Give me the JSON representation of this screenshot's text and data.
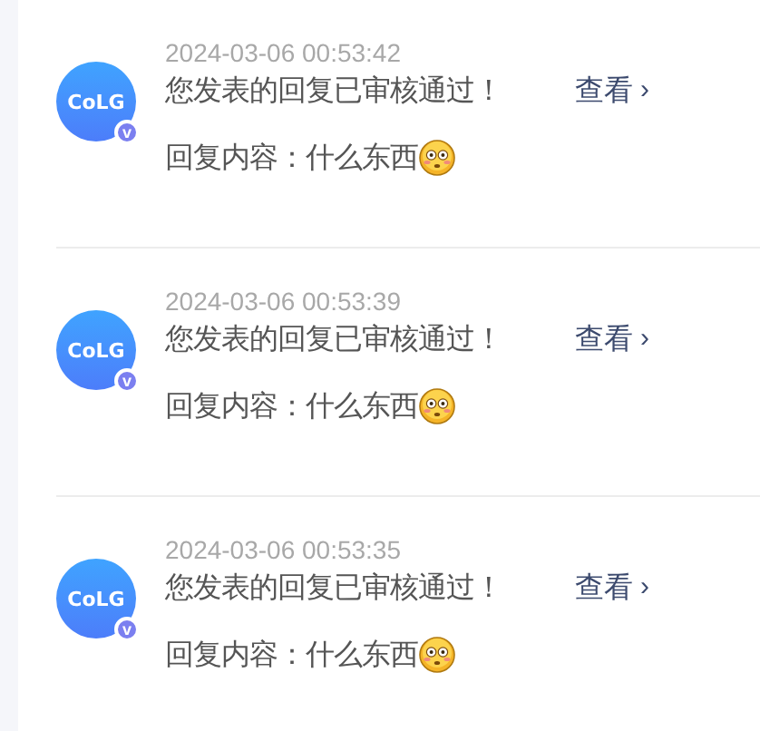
{
  "notifications": [
    {
      "avatar_text": "CoLG",
      "badge": "v",
      "time": "2024-03-06 00:53:42",
      "message": "您发表的回复已审核通过！",
      "link": "查看",
      "link_arrow": "›",
      "reply": "回复内容：什么东西"
    },
    {
      "avatar_text": "CoLG",
      "badge": "v",
      "time": "2024-03-06 00:53:39",
      "message": "您发表的回复已审核通过！",
      "link": "查看",
      "link_arrow": "›",
      "reply": "回复内容：什么东西"
    },
    {
      "avatar_text": "CoLG",
      "badge": "v",
      "time": "2024-03-06 00:53:35",
      "message": "您发表的回复已审核通过！",
      "link": "查看",
      "link_arrow": "›",
      "reply": "回复内容：什么东西"
    }
  ]
}
